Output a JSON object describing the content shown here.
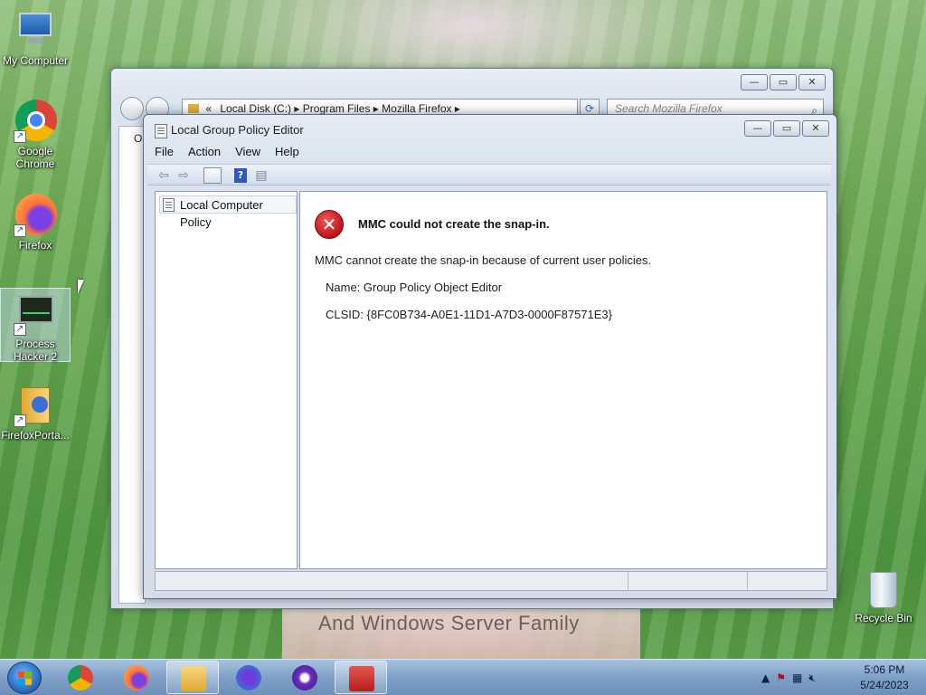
{
  "desktop": {
    "icons": [
      {
        "label": "My Computer"
      },
      {
        "label": "Google Chrome"
      },
      {
        "label": "Firefox"
      },
      {
        "label": "Process Hacker 2"
      },
      {
        "label": "FirefoxPorta..."
      }
    ],
    "recycle_bin": "Recycle Bin",
    "wallpaper_text": "And Windows Server Family"
  },
  "explorer": {
    "address": {
      "prefix": "«",
      "crumbs": [
        "Local Disk (C:)",
        "Program Files",
        "Mozilla Firefox"
      ]
    },
    "search_placeholder": "Search Mozilla Firefox",
    "sidebar_fragment": "Or"
  },
  "mmc": {
    "title": "Local Group Policy Editor",
    "menu": [
      "File",
      "Action",
      "View",
      "Help"
    ],
    "tree_root": "Local Computer Policy",
    "error": {
      "title": "MMC could not create the snap-in.",
      "message": "MMC cannot create the snap-in because of current user policies.",
      "name_line": "Name: Group Policy Object Editor",
      "clsid_line": "CLSID: {8FC0B734-A0E1-11D1-A7D3-0000F87571E3}"
    }
  },
  "window_buttons": {
    "minimize": "—",
    "maximize": "▭",
    "close": "✕"
  },
  "taskbar": {
    "apps": [
      "Google Chrome",
      "Firefox",
      "Windows Explorer",
      "Firefox Portable",
      "Process Hacker",
      "Local Group Policy Editor"
    ],
    "time": "5:06 PM",
    "date": "5/24/2023"
  },
  "colors": {
    "error_red": "#c6161c",
    "taskbar": "#7fa1c8",
    "selection": "#cfe0f5"
  }
}
